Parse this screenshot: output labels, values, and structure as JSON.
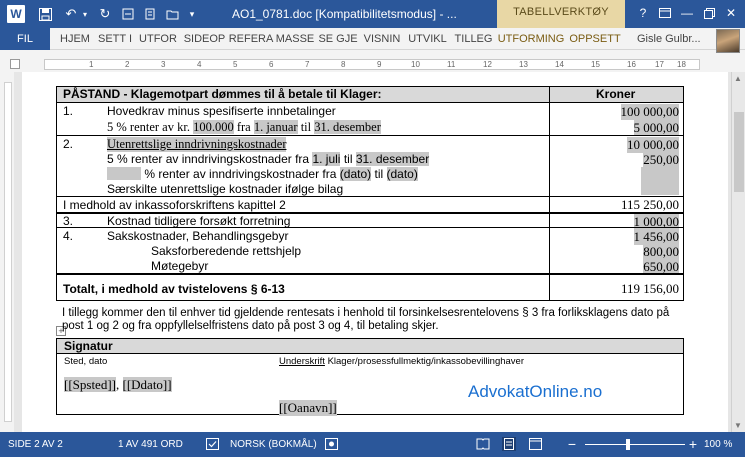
{
  "window": {
    "title": "AO1_0781.doc [Kompatibilitetsmodus] - ...",
    "app_icon": "word-logo-icon",
    "context_tools_label": "TABELLVERKTØY",
    "accent": "#2b579a"
  },
  "quick_access": {
    "save_icon": "save-icon",
    "undo_icon": "undo-icon",
    "redo_icon": "redo-icon"
  },
  "ribbon": {
    "file_tab": "FIL",
    "tabs": [
      "HJEM",
      "SETT I",
      "UTFOR",
      "SIDEOP",
      "REFERA",
      "MASSE",
      "SE GJE",
      "VISNIN",
      "UTVIKL",
      "TILLEG"
    ],
    "context_tabs": [
      "UTFORMING",
      "OPPSETT"
    ],
    "user_name": "Gisle Gulbr..."
  },
  "ruler": {
    "labels": [
      "1",
      "2",
      "3",
      "4",
      "5",
      "6",
      "7",
      "8",
      "9",
      "10",
      "11",
      "12",
      "13",
      "14",
      "15",
      "16",
      "17",
      "18"
    ]
  },
  "claim_table": {
    "header_left": "PÅSTAND - Klagemotpart dømmes til å betale til Klager:",
    "header_right": "Kroner",
    "r1": {
      "num": "1.",
      "title": "Hovedkrav minus spesifiserte innbetalinger",
      "interest_text": "5 % renter av kr.",
      "interest_amount": "100.000",
      "from_word": "fra",
      "from_date": "1. januar",
      "to_word": "til",
      "to_date": "31. desember",
      "amount1": "100 000,00",
      "amount2": "5 000,00"
    },
    "r2": {
      "num": "2.",
      "title": "Utenrettslige inndrivningskostnader",
      "line2_text": "5 % renter av inndrivingskostnader fra",
      "line2_from": "1. juli",
      "line2_to_word": "til",
      "line2_to": "31. desember",
      "line3_text": "% renter av inndrivingskostnader fra",
      "line3_from": "(dato)",
      "line3_to_word": "til",
      "line3_to": "(dato)",
      "line4": "Særskilte utenrettslige kostnader ifølge bilag",
      "amount1": "10 000,00",
      "amount2": "250,00"
    },
    "subtotal_label": "I medhold av inkassoforskriftens kapittel 2",
    "subtotal_amount": "115 250,00",
    "r3": {
      "num": "3.",
      "title": "Kostnad tidligere forsøkt forretning",
      "amount": "1 000,00"
    },
    "r4": {
      "num": "4.",
      "title": "Sakskostnader, Behandlingsgebyr",
      "sub1": "Saksforberedende rettshjelp",
      "sub2": "Møtegebyr",
      "amount1": "1 456,00",
      "amount2": "800,00",
      "amount3": "650,00"
    },
    "total_label": "Totalt, i medhold av tvistelovens § 6-13",
    "total_amount": "119 156,00"
  },
  "addendum": "I tillegg kommer den til enhver tid gjeldende rentesats i henhold til forsinkelsesrentelovens § 3 fra forliksklagens dato på post 1 og 2 og fra oppfyllelselfristens dato på post 3 og 4, til betaling skjer.",
  "signature": {
    "heading": "Signatur",
    "place_date_label": "Sted, dato",
    "underskrift": "Underskrift",
    "signer_label": " Klager/prosessfullmektig/inkassobevillinghaver",
    "place_field": "[[Spsted]]",
    "sep": ", ",
    "date_field": "[[Ddato]]",
    "name_field": "[[Oanavn]]"
  },
  "brand_text": "AdvokatOnline.no",
  "statusbar": {
    "page": "SIDE 2 AV 2",
    "words": "1 AV 491 ORD",
    "language": "NORSK (BOKMÅL)",
    "zoom": "100 %",
    "zoom_percent": 100
  }
}
